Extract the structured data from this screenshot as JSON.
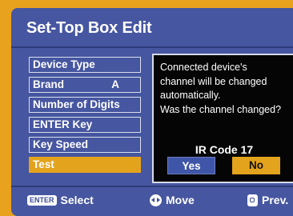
{
  "title": "Set-Top Box Edit",
  "menu": [
    {
      "label": "Device Type",
      "value": ""
    },
    {
      "label": "Brand",
      "value": "A"
    },
    {
      "label": "Number of Digits",
      "value": ""
    },
    {
      "label": "ENTER Key",
      "value": ""
    },
    {
      "label": "Key Speed",
      "value": ""
    },
    {
      "label": "Test",
      "value": ""
    }
  ],
  "selected_item": "Test",
  "dialog": {
    "message_lines": [
      "Connected device's",
      "channel will be changed",
      "automatically.",
      "Was the channel changed?"
    ],
    "ir_code": "IR Code 17",
    "yes_label": "Yes",
    "no_label": "No"
  },
  "footer": {
    "enter_icon_text": "ENTER",
    "select_label": "Select",
    "move_label": "Move",
    "prev_label": "Prev."
  },
  "colors": {
    "panel": "#4656a0",
    "highlight": "#e4a31c",
    "dialog_bg": "#050505"
  }
}
